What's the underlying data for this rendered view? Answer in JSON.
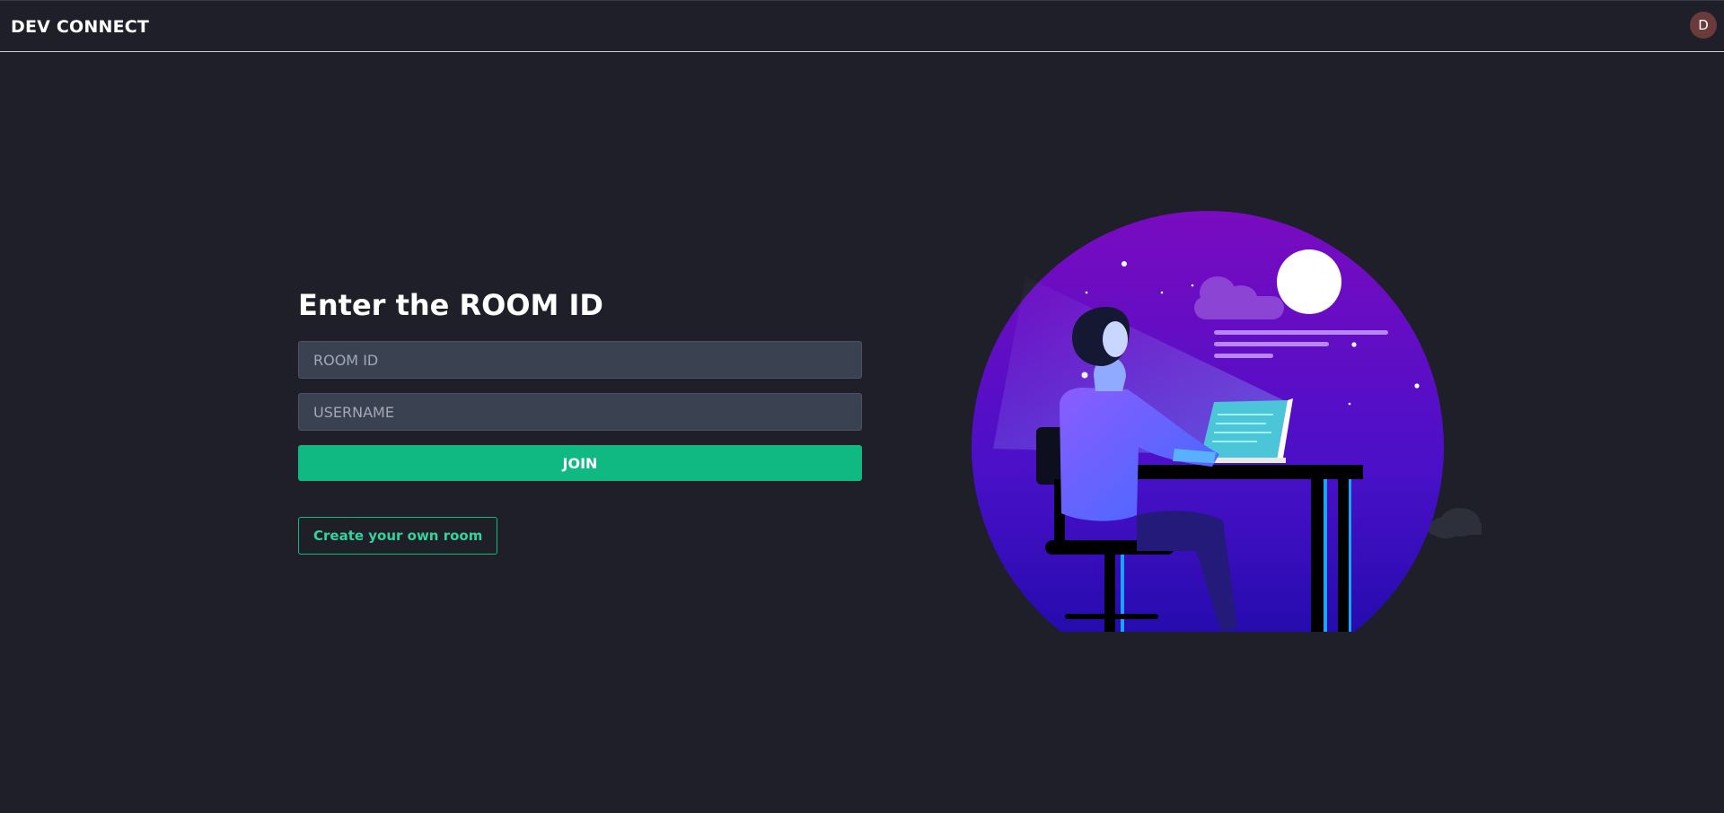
{
  "navbar": {
    "brand": "DEV CONNECT",
    "avatar_initial": "D"
  },
  "join_form": {
    "heading": "Enter the ROOM ID",
    "room_id": {
      "value": "",
      "placeholder": "ROOM ID"
    },
    "username": {
      "value": "",
      "placeholder": "USERNAME"
    },
    "join_label": "JOIN",
    "create_label": "Create your own room"
  },
  "illustration": {
    "subject": "developer-at-desk-night-scene",
    "colors": {
      "sky_top": "#7209b7",
      "sky_bottom": "#1d0fa8",
      "accent": "#10b981"
    }
  }
}
